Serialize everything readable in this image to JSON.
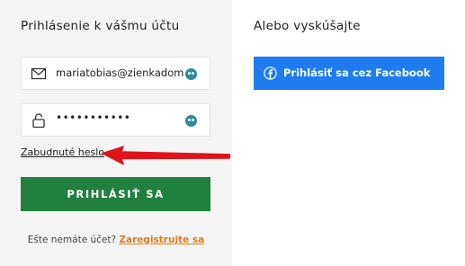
{
  "login": {
    "heading": "Prihlásenie k vášmu účtu",
    "email_value": "mariatobias@zienkadomaca.sk",
    "password_value": "•••••••••••",
    "forgot_label": "Zabudnuté heslo",
    "submit_label": "PRIHLÁSIŤ SA",
    "no_account_text": "Ešte nemáte účet?",
    "register_link": "Zaregistrujte sa"
  },
  "alt": {
    "heading": "Alebo vyskúšajte",
    "facebook_label": "Prihlásiť sa cez Facebook"
  },
  "icons": {
    "email": "envelope-icon",
    "password": "lock-icon",
    "autofill": "password-manager-icon",
    "facebook": "facebook-icon",
    "annotation": "red-arrow"
  },
  "colors": {
    "panel_bg": "#f4f4f4",
    "submit_bg": "#22803f",
    "facebook_bg": "#1f7cf0",
    "link_accent": "#e07c1c",
    "arrow": "#e0121b"
  }
}
